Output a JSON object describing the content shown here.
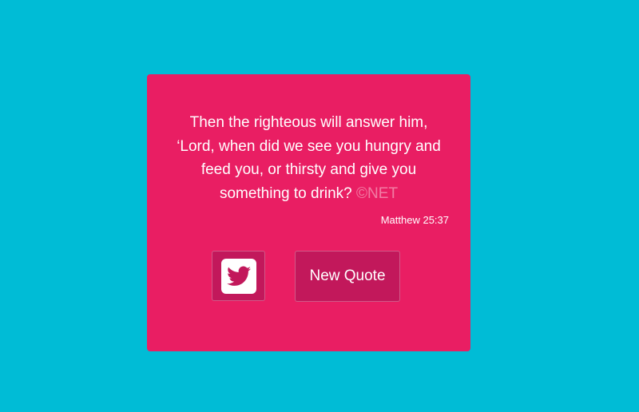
{
  "colors": {
    "background": "#00bcd6",
    "card": "#e91e63",
    "button": "#c2185b",
    "text": "#ffffff"
  },
  "quote": {
    "text": "Then the righteous will answer him, ‘Lord, when did we see you hungry and feed you, or thirsty and give you something to drink?",
    "attribution": "©NET",
    "author": "Matthew 25:37"
  },
  "buttons": {
    "tweet_icon": "twitter-icon",
    "new_quote_label": "New Quote"
  }
}
